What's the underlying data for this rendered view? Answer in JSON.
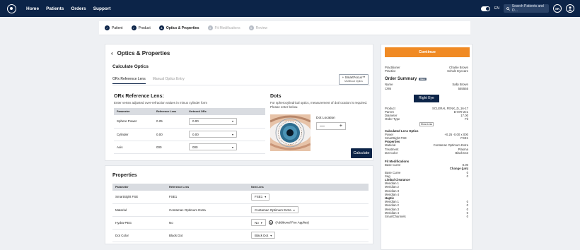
{
  "nav": {
    "items": [
      "Home",
      "Patients",
      "Orders",
      "Support"
    ],
    "lang": "EN",
    "search_placeholder": "Search Patients and O...",
    "avatar_initials": "SK"
  },
  "stepper": [
    {
      "label": "Patient",
      "state": "done"
    },
    {
      "label": "Product",
      "state": "done"
    },
    {
      "label": "Optics & Properties",
      "state": "active",
      "num": "3"
    },
    {
      "label": "Fit Modifications",
      "state": "pending",
      "num": "4"
    },
    {
      "label": "Review",
      "state": "pending",
      "num": "5"
    }
  ],
  "main": {
    "title": "Optics & Properties",
    "subtitle": "Calculate Optics",
    "tabs": [
      "ORx Reference Lens",
      "Manual Optics Entry"
    ],
    "smart_btn": "SmartFocus™",
    "smart_btn_sub": "Multifocal Optics",
    "orx_title": "ORx Reference Lens:",
    "orx_desc": "Enter vertex adjusted over-refraction values in minus cylinder form",
    "orx_headers": [
      "Parameter",
      "Reference Lens",
      "Vertexed ORx"
    ],
    "orx_rows": [
      {
        "param": "Sphere Power",
        "ref": "0.25",
        "val": "0.00"
      },
      {
        "param": "Cylinder",
        "ref": "0.00",
        "val": "0.00"
      },
      {
        "param": "Axis",
        "ref": "000",
        "val": "000"
      }
    ],
    "dots_title": "Dots",
    "dots_desc": "For spherocylindrical optics, measurement of dot location is required. Please enter below.",
    "dot_location_label": "Dot Location",
    "dot_minus": "—",
    "dot_plus": "+",
    "calculate": "Calculate"
  },
  "properties": {
    "title": "Properties",
    "headers": [
      "Parameter",
      "Reference Lens",
      "New Lens"
    ],
    "rows": [
      {
        "param": "SmartSight FSE",
        "ref": "FSE1",
        "val": "FSE1",
        "note": ""
      },
      {
        "param": "Material",
        "ref": "Contamac Optimum Extra",
        "val": "Contamac Optimum Extra",
        "note": ""
      },
      {
        "param": "Hydra-PEG",
        "ref": "No",
        "val": "No",
        "note": "(Additional Fee Applies)"
      },
      {
        "param": "Dot Color",
        "ref": "Black Dot",
        "val": "Black Dot",
        "note": ""
      }
    ]
  },
  "summary": {
    "continue": "Continue",
    "practitioner_k": "Practitioner",
    "practitioner_v": "Charlie Brown",
    "practice_k": "Practice",
    "practice_v": "Schulz Eyecare",
    "title": "Order Summary",
    "badge": "New",
    "name_k": "Name",
    "name_v": "Sally Brown",
    "crn_k": "CRN",
    "crn_v": "555555",
    "eye": "Right Eye",
    "product_k": "Product",
    "product_v": "SCLERAL FENX_D_16-17",
    "parent_k": "Parent",
    "parent_v": "D-870-2e1",
    "diameter_k": "Diameter",
    "diameter_v": "17.00",
    "ordertype_k": "Order Type",
    "ordertype_v": "Fit",
    "show_less": "Show Less",
    "calc_optics": "Calculated Lens Optics",
    "power_k": "Power",
    "power_v": "+0.25 -0.00 x 000",
    "fse_k": "SmartSight FSE",
    "fse_v": "FSE1",
    "properties": "Properties",
    "material_k": "Material",
    "material_v": "Contamac Optimum Extra",
    "treatment_k": "Treatment",
    "treatment_v": "Plasma",
    "dotcolor_k": "Dot Color",
    "dotcolor_v": "Black Dot",
    "fitmods": "Fit Modifications",
    "basecurve_k": "Base Curve",
    "basecurve_v": "8.00",
    "change_label": "Change (μm)",
    "basecurve2_k": "Base Curve",
    "basecurve2_v": "0",
    "sag_k": "Sag",
    "sag_v": "0",
    "limbal": "Limbal Clearance",
    "limbal_items": [
      {
        "k": "Meridian 1",
        "v": ""
      },
      {
        "k": "Meridian 2",
        "v": ""
      },
      {
        "k": "Meridian 3",
        "v": ""
      },
      {
        "k": "Meridian 4",
        "v": ""
      }
    ],
    "haptic": "Haptic",
    "haptic_items": [
      {
        "k": "Meridian 1",
        "v": "0"
      },
      {
        "k": "Meridian 2",
        "v": "0"
      },
      {
        "k": "Meridian 3",
        "v": "0"
      },
      {
        "k": "Meridian 4",
        "v": "0"
      }
    ],
    "smartchannels_k": "SmartChannels",
    "smartchannels_v": "0"
  },
  "colors": {
    "navy": "#0c2448",
    "orange": "#f08a24"
  }
}
